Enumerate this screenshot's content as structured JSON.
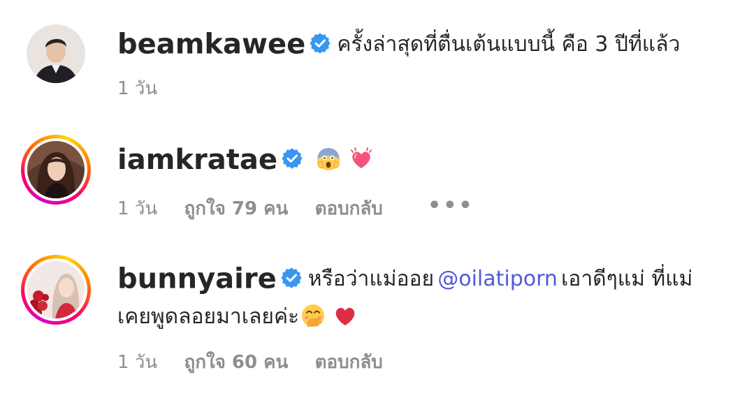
{
  "comments": [
    {
      "username": "beamkawee",
      "verified": true,
      "text": "ครั้งล่าสุดที่ตื่นเต้นแบบนี้ คือ 3 ปีที่แล้ว",
      "time": "1 วัน",
      "avatar_ring": false
    },
    {
      "username": "iamkratae",
      "verified": true,
      "emojis": [
        "face-screaming-in-fear-emoji",
        "beating-heart-emoji"
      ],
      "time": "1 วัน",
      "likes": "ถูกใจ 79 คน",
      "reply": "ตอบกลับ",
      "more": "•••",
      "avatar_ring": true
    },
    {
      "username": "bunnyaire",
      "verified": true,
      "text_before": "หรือว่าแม่ออย",
      "mention": "@oilatiporn",
      "text_after": "เอาดีๆแม่ ที่แม่",
      "text_line2": "เคยพูดลอยมาเลยค่ะ",
      "emojis": [
        "face-with-hand-over-mouth-emoji",
        "red-heart-emoji"
      ],
      "time": "1 วัน",
      "likes": "ถูกใจ 60 คน",
      "reply": "ตอบกลับ",
      "avatar_ring": true
    }
  ],
  "colors": {
    "text": "#262626",
    "secondary": "#8e8e8e",
    "mention": "#4f5bd5",
    "verified": "#3897f0"
  }
}
